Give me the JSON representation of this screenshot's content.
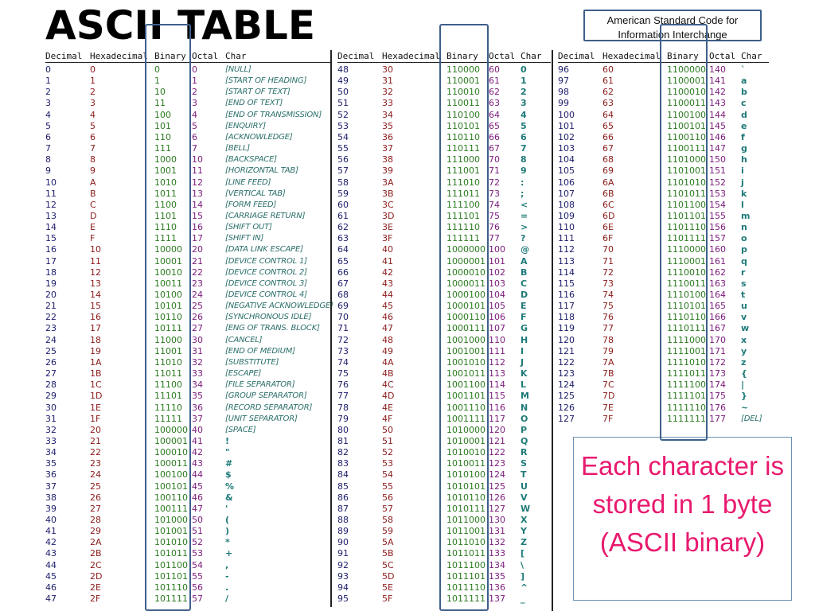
{
  "title": "ASCII TABLE",
  "subtitle": "American Standard Code for Information Interchange",
  "note": "Each character is stored in 1 byte (ASCII binary)",
  "colors": {
    "decimal": "#1c1c6b",
    "hexadecimal": "#8b1a1a",
    "binary": "#2a7a1e",
    "octal": "#7a1a7a",
    "char": "#1e7a78",
    "frame": "#3e5f8a",
    "note": "#e8196e"
  },
  "headers": [
    "Decimal",
    "Hexadecimal",
    "Binary",
    "Octal",
    "Char"
  ],
  "sections": [
    {
      "rows": [
        [
          "0",
          "0",
          "0",
          "0",
          "[NULL]"
        ],
        [
          "1",
          "1",
          "1",
          "1",
          "[START OF HEADING]"
        ],
        [
          "2",
          "2",
          "10",
          "2",
          "[START OF TEXT]"
        ],
        [
          "3",
          "3",
          "11",
          "3",
          "[END OF TEXT]"
        ],
        [
          "4",
          "4",
          "100",
          "4",
          "[END OF TRANSMISSION]"
        ],
        [
          "5",
          "5",
          "101",
          "5",
          "[ENQUIRY]"
        ],
        [
          "6",
          "6",
          "110",
          "6",
          "[ACKNOWLEDGE]"
        ],
        [
          "7",
          "7",
          "111",
          "7",
          "[BELL]"
        ],
        [
          "8",
          "8",
          "1000",
          "10",
          "[BACKSPACE]"
        ],
        [
          "9",
          "9",
          "1001",
          "11",
          "[HORIZONTAL TAB]"
        ],
        [
          "10",
          "A",
          "1010",
          "12",
          "[LINE FEED]"
        ],
        [
          "11",
          "B",
          "1011",
          "13",
          "[VERTICAL TAB]"
        ],
        [
          "12",
          "C",
          "1100",
          "14",
          "[FORM FEED]"
        ],
        [
          "13",
          "D",
          "1101",
          "15",
          "[CARRIAGE RETURN]"
        ],
        [
          "14",
          "E",
          "1110",
          "16",
          "[SHIFT OUT]"
        ],
        [
          "15",
          "F",
          "1111",
          "17",
          "[SHIFT IN]"
        ],
        [
          "16",
          "10",
          "10000",
          "20",
          "[DATA LINK ESCAPE]"
        ],
        [
          "17",
          "11",
          "10001",
          "21",
          "[DEVICE CONTROL 1]"
        ],
        [
          "18",
          "12",
          "10010",
          "22",
          "[DEVICE CONTROL 2]"
        ],
        [
          "19",
          "13",
          "10011",
          "23",
          "[DEVICE CONTROL 3]"
        ],
        [
          "20",
          "14",
          "10100",
          "24",
          "[DEVICE CONTROL 4]"
        ],
        [
          "21",
          "15",
          "10101",
          "25",
          "[NEGATIVE ACKNOWLEDGE]"
        ],
        [
          "22",
          "16",
          "10110",
          "26",
          "[SYNCHRONOUS IDLE]"
        ],
        [
          "23",
          "17",
          "10111",
          "27",
          "[ENG OF TRANS. BLOCK]"
        ],
        [
          "24",
          "18",
          "11000",
          "30",
          "[CANCEL]"
        ],
        [
          "25",
          "19",
          "11001",
          "31",
          "[END OF MEDIUM]"
        ],
        [
          "26",
          "1A",
          "11010",
          "32",
          "[SUBSTITUTE]"
        ],
        [
          "27",
          "1B",
          "11011",
          "33",
          "[ESCAPE]"
        ],
        [
          "28",
          "1C",
          "11100",
          "34",
          "[FILE SEPARATOR]"
        ],
        [
          "29",
          "1D",
          "11101",
          "35",
          "[GROUP SEPARATOR]"
        ],
        [
          "30",
          "1E",
          "11110",
          "36",
          "[RECORD SEPARATOR]"
        ],
        [
          "31",
          "1F",
          "11111",
          "37",
          "[UNIT SEPARATOR]"
        ],
        [
          "32",
          "20",
          "100000",
          "40",
          "[SPACE]"
        ],
        [
          "33",
          "21",
          "100001",
          "41",
          "!"
        ],
        [
          "34",
          "22",
          "100010",
          "42",
          "\""
        ],
        [
          "35",
          "23",
          "100011",
          "43",
          "#"
        ],
        [
          "36",
          "24",
          "100100",
          "44",
          "$"
        ],
        [
          "37",
          "25",
          "100101",
          "45",
          "%"
        ],
        [
          "38",
          "26",
          "100110",
          "46",
          "&"
        ],
        [
          "39",
          "27",
          "100111",
          "47",
          "'"
        ],
        [
          "40",
          "28",
          "101000",
          "50",
          "("
        ],
        [
          "41",
          "29",
          "101001",
          "51",
          ")"
        ],
        [
          "42",
          "2A",
          "101010",
          "52",
          "*"
        ],
        [
          "43",
          "2B",
          "101011",
          "53",
          "+"
        ],
        [
          "44",
          "2C",
          "101100",
          "54",
          ","
        ],
        [
          "45",
          "2D",
          "101101",
          "55",
          "-"
        ],
        [
          "46",
          "2E",
          "101110",
          "56",
          "."
        ],
        [
          "47",
          "2F",
          "101111",
          "57",
          "/"
        ]
      ]
    },
    {
      "rows": [
        [
          "48",
          "30",
          "110000",
          "60",
          "0"
        ],
        [
          "49",
          "31",
          "110001",
          "61",
          "1"
        ],
        [
          "50",
          "32",
          "110010",
          "62",
          "2"
        ],
        [
          "51",
          "33",
          "110011",
          "63",
          "3"
        ],
        [
          "52",
          "34",
          "110100",
          "64",
          "4"
        ],
        [
          "53",
          "35",
          "110101",
          "65",
          "5"
        ],
        [
          "54",
          "36",
          "110110",
          "66",
          "6"
        ],
        [
          "55",
          "37",
          "110111",
          "67",
          "7"
        ],
        [
          "56",
          "38",
          "111000",
          "70",
          "8"
        ],
        [
          "57",
          "39",
          "111001",
          "71",
          "9"
        ],
        [
          "58",
          "3A",
          "111010",
          "72",
          ":"
        ],
        [
          "59",
          "3B",
          "111011",
          "73",
          ";"
        ],
        [
          "60",
          "3C",
          "111100",
          "74",
          "<"
        ],
        [
          "61",
          "3D",
          "111101",
          "75",
          "="
        ],
        [
          "62",
          "3E",
          "111110",
          "76",
          ">"
        ],
        [
          "63",
          "3F",
          "111111",
          "77",
          "?"
        ],
        [
          "64",
          "40",
          "1000000",
          "100",
          "@"
        ],
        [
          "65",
          "41",
          "1000001",
          "101",
          "A"
        ],
        [
          "66",
          "42",
          "1000010",
          "102",
          "B"
        ],
        [
          "67",
          "43",
          "1000011",
          "103",
          "C"
        ],
        [
          "68",
          "44",
          "1000100",
          "104",
          "D"
        ],
        [
          "69",
          "45",
          "1000101",
          "105",
          "E"
        ],
        [
          "70",
          "46",
          "1000110",
          "106",
          "F"
        ],
        [
          "71",
          "47",
          "1000111",
          "107",
          "G"
        ],
        [
          "72",
          "48",
          "1001000",
          "110",
          "H"
        ],
        [
          "73",
          "49",
          "1001001",
          "111",
          "I"
        ],
        [
          "74",
          "4A",
          "1001010",
          "112",
          "J"
        ],
        [
          "75",
          "4B",
          "1001011",
          "113",
          "K"
        ],
        [
          "76",
          "4C",
          "1001100",
          "114",
          "L"
        ],
        [
          "77",
          "4D",
          "1001101",
          "115",
          "M"
        ],
        [
          "78",
          "4E",
          "1001110",
          "116",
          "N"
        ],
        [
          "79",
          "4F",
          "1001111",
          "117",
          "O"
        ],
        [
          "80",
          "50",
          "1010000",
          "120",
          "P"
        ],
        [
          "81",
          "51",
          "1010001",
          "121",
          "Q"
        ],
        [
          "82",
          "52",
          "1010010",
          "122",
          "R"
        ],
        [
          "83",
          "53",
          "1010011",
          "123",
          "S"
        ],
        [
          "84",
          "54",
          "1010100",
          "124",
          "T"
        ],
        [
          "85",
          "55",
          "1010101",
          "125",
          "U"
        ],
        [
          "86",
          "56",
          "1010110",
          "126",
          "V"
        ],
        [
          "87",
          "57",
          "1010111",
          "127",
          "W"
        ],
        [
          "88",
          "58",
          "1011000",
          "130",
          "X"
        ],
        [
          "89",
          "59",
          "1011001",
          "131",
          "Y"
        ],
        [
          "90",
          "5A",
          "1011010",
          "132",
          "Z"
        ],
        [
          "91",
          "5B",
          "1011011",
          "133",
          "["
        ],
        [
          "92",
          "5C",
          "1011100",
          "134",
          "\\"
        ],
        [
          "93",
          "5D",
          "1011101",
          "135",
          "]"
        ],
        [
          "94",
          "5E",
          "1011110",
          "136",
          "^"
        ],
        [
          "95",
          "5F",
          "1011111",
          "137",
          "_"
        ]
      ]
    },
    {
      "rows": [
        [
          "96",
          "60",
          "1100000",
          "140",
          "`"
        ],
        [
          "97",
          "61",
          "1100001",
          "141",
          "a"
        ],
        [
          "98",
          "62",
          "1100010",
          "142",
          "b"
        ],
        [
          "99",
          "63",
          "1100011",
          "143",
          "c"
        ],
        [
          "100",
          "64",
          "1100100",
          "144",
          "d"
        ],
        [
          "101",
          "65",
          "1100101",
          "145",
          "e"
        ],
        [
          "102",
          "66",
          "1100110",
          "146",
          "f"
        ],
        [
          "103",
          "67",
          "1100111",
          "147",
          "g"
        ],
        [
          "104",
          "68",
          "1101000",
          "150",
          "h"
        ],
        [
          "105",
          "69",
          "1101001",
          "151",
          "i"
        ],
        [
          "106",
          "6A",
          "1101010",
          "152",
          "j"
        ],
        [
          "107",
          "6B",
          "1101011",
          "153",
          "k"
        ],
        [
          "108",
          "6C",
          "1101100",
          "154",
          "l"
        ],
        [
          "109",
          "6D",
          "1101101",
          "155",
          "m"
        ],
        [
          "110",
          "6E",
          "1101110",
          "156",
          "n"
        ],
        [
          "111",
          "6F",
          "1101111",
          "157",
          "o"
        ],
        [
          "112",
          "70",
          "1110000",
          "160",
          "p"
        ],
        [
          "113",
          "71",
          "1110001",
          "161",
          "q"
        ],
        [
          "114",
          "72",
          "1110010",
          "162",
          "r"
        ],
        [
          "115",
          "73",
          "1110011",
          "163",
          "s"
        ],
        [
          "116",
          "74",
          "1110100",
          "164",
          "t"
        ],
        [
          "117",
          "75",
          "1110101",
          "165",
          "u"
        ],
        [
          "118",
          "76",
          "1110110",
          "166",
          "v"
        ],
        [
          "119",
          "77",
          "1110111",
          "167",
          "w"
        ],
        [
          "120",
          "78",
          "1111000",
          "170",
          "x"
        ],
        [
          "121",
          "79",
          "1111001",
          "171",
          "y"
        ],
        [
          "122",
          "7A",
          "1111010",
          "172",
          "z"
        ],
        [
          "123",
          "7B",
          "1111011",
          "173",
          "{"
        ],
        [
          "124",
          "7C",
          "1111100",
          "174",
          "|"
        ],
        [
          "125",
          "7D",
          "1111101",
          "175",
          "}"
        ],
        [
          "126",
          "7E",
          "1111110",
          "176",
          "~"
        ],
        [
          "127",
          "7F",
          "1111111",
          "177",
          "[DEL]"
        ]
      ]
    }
  ]
}
